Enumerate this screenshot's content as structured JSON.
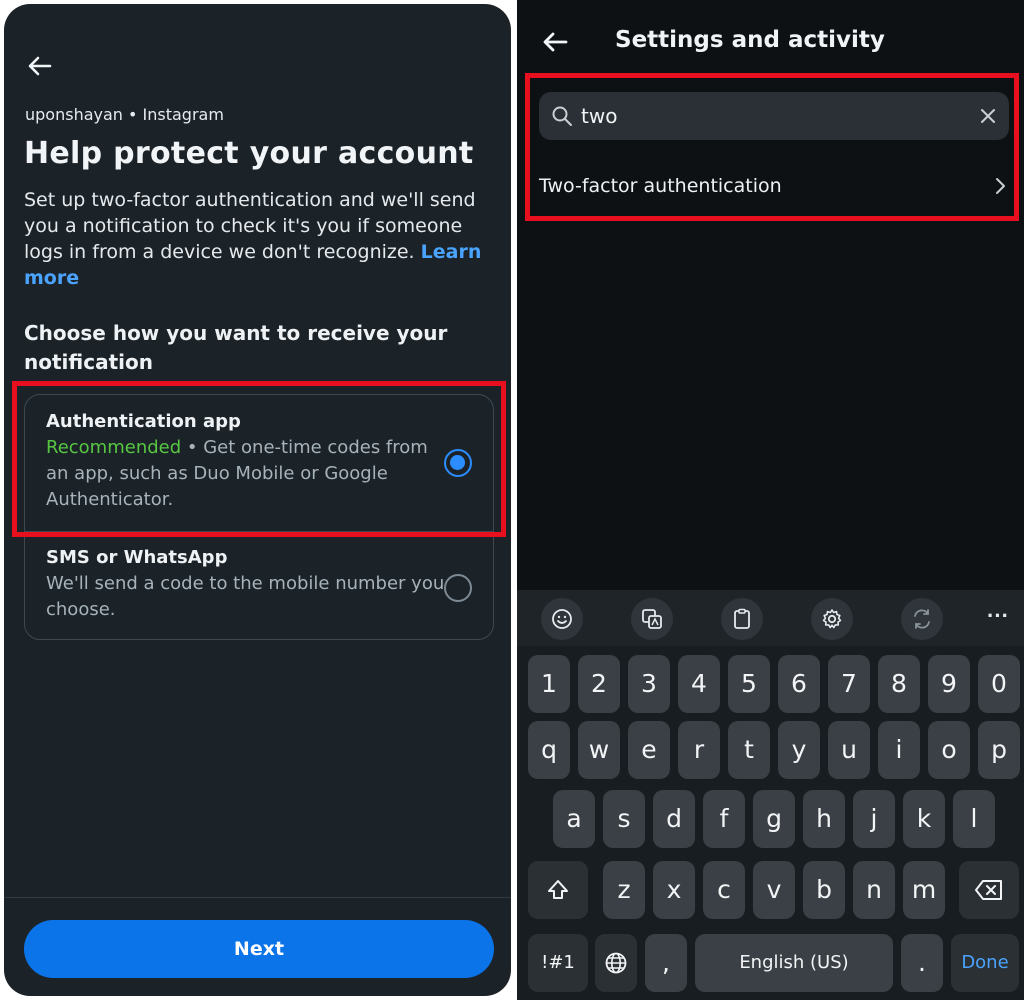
{
  "left": {
    "account": "uponshayan • Instagram",
    "heading": "Help protect your account",
    "description": "Set up two-factor authentication and we'll send you a notification to check it's you if someone logs in from a device we don't recognize.",
    "learn_more": "Learn more",
    "choose_heading": "Choose how you want to receive your notification",
    "options": [
      {
        "title": "Authentication app",
        "recommended": "Recommended",
        "subtitle": " • Get one-time codes from an app, such as Duo Mobile or Google Authenticator.",
        "selected": true
      },
      {
        "title": "SMS or WhatsApp",
        "subtitle": "We'll send a code to the mobile number you choose.",
        "selected": false
      }
    ],
    "next_button": "Next",
    "colors": {
      "accent": "#0a74e8",
      "recommended": "#57c742",
      "highlight": "#e8101f"
    }
  },
  "right": {
    "title": "Settings and activity",
    "search": {
      "value": "two"
    },
    "result": "Two-factor authentication",
    "keyboard": {
      "toolbar_icons": [
        "emoji-icon",
        "translate-icon",
        "clipboard-icon",
        "gear-icon",
        "swap-icon",
        "more-icon"
      ],
      "more": "···",
      "row_numbers": [
        "1",
        "2",
        "3",
        "4",
        "5",
        "6",
        "7",
        "8",
        "9",
        "0"
      ],
      "row1": [
        "q",
        "w",
        "e",
        "r",
        "t",
        "y",
        "u",
        "i",
        "o",
        "p"
      ],
      "row2": [
        "a",
        "s",
        "d",
        "f",
        "g",
        "h",
        "j",
        "k",
        "l"
      ],
      "row3": [
        "z",
        "x",
        "c",
        "v",
        "b",
        "n",
        "m"
      ],
      "symbols": "!#1",
      "comma": ",",
      "space": "English (US)",
      "period": ".",
      "done": "Done"
    }
  }
}
